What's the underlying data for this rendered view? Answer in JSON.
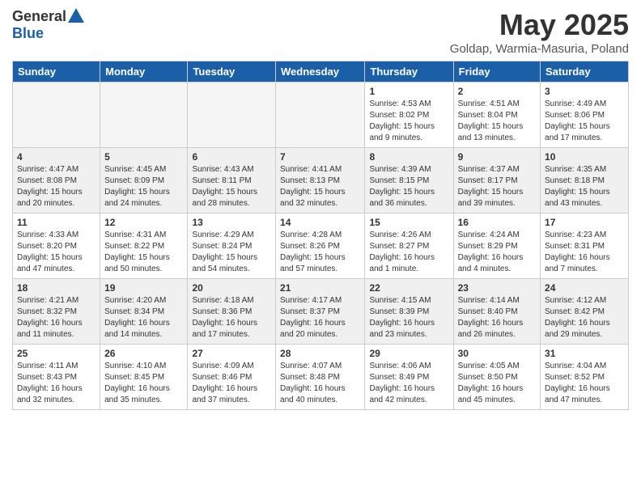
{
  "logo": {
    "general": "General",
    "blue": "Blue"
  },
  "title": {
    "month": "May 2025",
    "location": "Goldap, Warmia-Masuria, Poland"
  },
  "weekdays": [
    "Sunday",
    "Monday",
    "Tuesday",
    "Wednesday",
    "Thursday",
    "Friday",
    "Saturday"
  ],
  "weeks": [
    [
      {
        "num": "",
        "info": "",
        "empty": true
      },
      {
        "num": "",
        "info": "",
        "empty": true
      },
      {
        "num": "",
        "info": "",
        "empty": true
      },
      {
        "num": "",
        "info": "",
        "empty": true
      },
      {
        "num": "1",
        "info": "Sunrise: 4:53 AM\nSunset: 8:02 PM\nDaylight: 15 hours\nand 9 minutes."
      },
      {
        "num": "2",
        "info": "Sunrise: 4:51 AM\nSunset: 8:04 PM\nDaylight: 15 hours\nand 13 minutes."
      },
      {
        "num": "3",
        "info": "Sunrise: 4:49 AM\nSunset: 8:06 PM\nDaylight: 15 hours\nand 17 minutes."
      }
    ],
    [
      {
        "num": "4",
        "info": "Sunrise: 4:47 AM\nSunset: 8:08 PM\nDaylight: 15 hours\nand 20 minutes.",
        "shaded": true
      },
      {
        "num": "5",
        "info": "Sunrise: 4:45 AM\nSunset: 8:09 PM\nDaylight: 15 hours\nand 24 minutes.",
        "shaded": true
      },
      {
        "num": "6",
        "info": "Sunrise: 4:43 AM\nSunset: 8:11 PM\nDaylight: 15 hours\nand 28 minutes.",
        "shaded": true
      },
      {
        "num": "7",
        "info": "Sunrise: 4:41 AM\nSunset: 8:13 PM\nDaylight: 15 hours\nand 32 minutes.",
        "shaded": true
      },
      {
        "num": "8",
        "info": "Sunrise: 4:39 AM\nSunset: 8:15 PM\nDaylight: 15 hours\nand 36 minutes.",
        "shaded": true
      },
      {
        "num": "9",
        "info": "Sunrise: 4:37 AM\nSunset: 8:17 PM\nDaylight: 15 hours\nand 39 minutes.",
        "shaded": true
      },
      {
        "num": "10",
        "info": "Sunrise: 4:35 AM\nSunset: 8:18 PM\nDaylight: 15 hours\nand 43 minutes.",
        "shaded": true
      }
    ],
    [
      {
        "num": "11",
        "info": "Sunrise: 4:33 AM\nSunset: 8:20 PM\nDaylight: 15 hours\nand 47 minutes."
      },
      {
        "num": "12",
        "info": "Sunrise: 4:31 AM\nSunset: 8:22 PM\nDaylight: 15 hours\nand 50 minutes."
      },
      {
        "num": "13",
        "info": "Sunrise: 4:29 AM\nSunset: 8:24 PM\nDaylight: 15 hours\nand 54 minutes."
      },
      {
        "num": "14",
        "info": "Sunrise: 4:28 AM\nSunset: 8:26 PM\nDaylight: 15 hours\nand 57 minutes."
      },
      {
        "num": "15",
        "info": "Sunrise: 4:26 AM\nSunset: 8:27 PM\nDaylight: 16 hours\nand 1 minute."
      },
      {
        "num": "16",
        "info": "Sunrise: 4:24 AM\nSunset: 8:29 PM\nDaylight: 16 hours\nand 4 minutes."
      },
      {
        "num": "17",
        "info": "Sunrise: 4:23 AM\nSunset: 8:31 PM\nDaylight: 16 hours\nand 7 minutes."
      }
    ],
    [
      {
        "num": "18",
        "info": "Sunrise: 4:21 AM\nSunset: 8:32 PM\nDaylight: 16 hours\nand 11 minutes.",
        "shaded": true
      },
      {
        "num": "19",
        "info": "Sunrise: 4:20 AM\nSunset: 8:34 PM\nDaylight: 16 hours\nand 14 minutes.",
        "shaded": true
      },
      {
        "num": "20",
        "info": "Sunrise: 4:18 AM\nSunset: 8:36 PM\nDaylight: 16 hours\nand 17 minutes.",
        "shaded": true
      },
      {
        "num": "21",
        "info": "Sunrise: 4:17 AM\nSunset: 8:37 PM\nDaylight: 16 hours\nand 20 minutes.",
        "shaded": true
      },
      {
        "num": "22",
        "info": "Sunrise: 4:15 AM\nSunset: 8:39 PM\nDaylight: 16 hours\nand 23 minutes.",
        "shaded": true
      },
      {
        "num": "23",
        "info": "Sunrise: 4:14 AM\nSunset: 8:40 PM\nDaylight: 16 hours\nand 26 minutes.",
        "shaded": true
      },
      {
        "num": "24",
        "info": "Sunrise: 4:12 AM\nSunset: 8:42 PM\nDaylight: 16 hours\nand 29 minutes.",
        "shaded": true
      }
    ],
    [
      {
        "num": "25",
        "info": "Sunrise: 4:11 AM\nSunset: 8:43 PM\nDaylight: 16 hours\nand 32 minutes."
      },
      {
        "num": "26",
        "info": "Sunrise: 4:10 AM\nSunset: 8:45 PM\nDaylight: 16 hours\nand 35 minutes."
      },
      {
        "num": "27",
        "info": "Sunrise: 4:09 AM\nSunset: 8:46 PM\nDaylight: 16 hours\nand 37 minutes."
      },
      {
        "num": "28",
        "info": "Sunrise: 4:07 AM\nSunset: 8:48 PM\nDaylight: 16 hours\nand 40 minutes."
      },
      {
        "num": "29",
        "info": "Sunrise: 4:06 AM\nSunset: 8:49 PM\nDaylight: 16 hours\nand 42 minutes."
      },
      {
        "num": "30",
        "info": "Sunrise: 4:05 AM\nSunset: 8:50 PM\nDaylight: 16 hours\nand 45 minutes."
      },
      {
        "num": "31",
        "info": "Sunrise: 4:04 AM\nSunset: 8:52 PM\nDaylight: 16 hours\nand 47 minutes."
      }
    ]
  ]
}
